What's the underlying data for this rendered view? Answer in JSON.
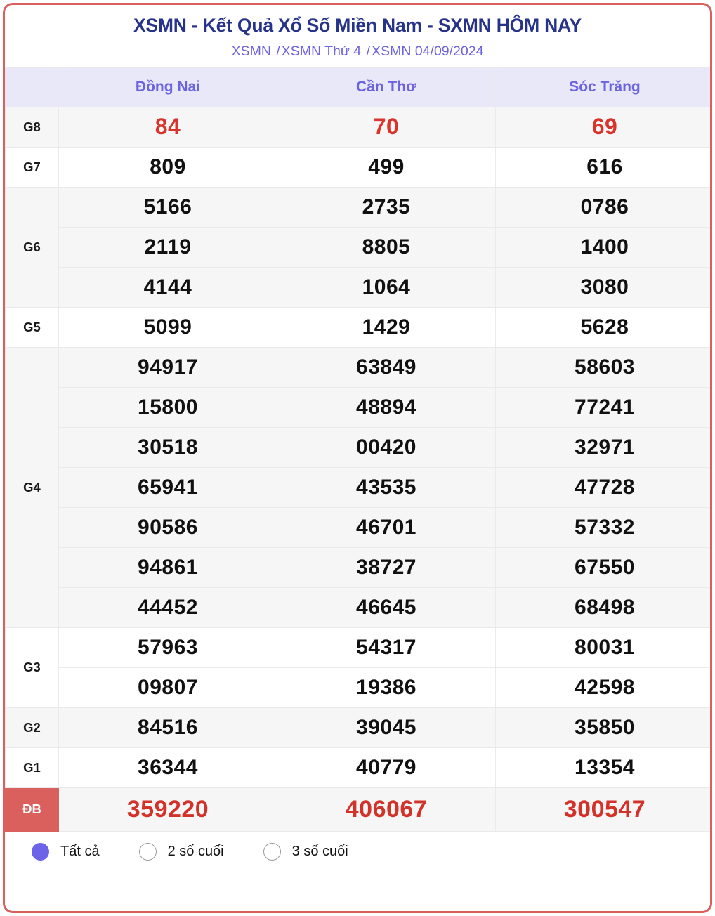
{
  "header": {
    "title": "XSMN - Kết Quả Xổ Số Miền Nam - SXMN HÔM NAY",
    "breadcrumb": {
      "items": [
        "XSMN ",
        "XSMN Thứ 4 ",
        "XSMN 04/09/2024"
      ],
      "separator": "/"
    }
  },
  "table": {
    "corner_label": "",
    "provinces": [
      "Đồng Nai",
      "Cần Thơ",
      "Sóc Trăng"
    ],
    "prizes": [
      {
        "label": "G8",
        "style": "red",
        "band": "grey",
        "rows": [
          [
            "84",
            "70",
            "69"
          ]
        ]
      },
      {
        "label": "G7",
        "style": "normal",
        "band": "white",
        "rows": [
          [
            "809",
            "499",
            "616"
          ]
        ]
      },
      {
        "label": "G6",
        "style": "normal",
        "band": "grey",
        "rows": [
          [
            "5166",
            "2735",
            "0786"
          ],
          [
            "2119",
            "8805",
            "1400"
          ],
          [
            "4144",
            "1064",
            "3080"
          ]
        ]
      },
      {
        "label": "G5",
        "style": "normal",
        "band": "white",
        "rows": [
          [
            "5099",
            "1429",
            "5628"
          ]
        ]
      },
      {
        "label": "G4",
        "style": "normal",
        "band": "grey",
        "rows": [
          [
            "94917",
            "63849",
            "58603"
          ],
          [
            "15800",
            "48894",
            "77241"
          ],
          [
            "30518",
            "00420",
            "32971"
          ],
          [
            "65941",
            "43535",
            "47728"
          ],
          [
            "90586",
            "46701",
            "57332"
          ],
          [
            "94861",
            "38727",
            "67550"
          ],
          [
            "44452",
            "46645",
            "68498"
          ]
        ]
      },
      {
        "label": "G3",
        "style": "normal",
        "band": "white",
        "rows": [
          [
            "57963",
            "54317",
            "80031"
          ],
          [
            "09807",
            "19386",
            "42598"
          ]
        ]
      },
      {
        "label": "G2",
        "style": "normal",
        "band": "grey",
        "rows": [
          [
            "84516",
            "39045",
            "35850"
          ]
        ]
      },
      {
        "label": "G1",
        "style": "normal",
        "band": "white",
        "rows": [
          [
            "36344",
            "40779",
            "13354"
          ]
        ]
      },
      {
        "label": "ĐB",
        "style": "db",
        "band": "grey",
        "rows": [
          [
            "359220",
            "406067",
            "300547"
          ]
        ]
      }
    ]
  },
  "filters": {
    "options": [
      {
        "label": "Tất cả",
        "selected": true
      },
      {
        "label": "2 số cuối",
        "selected": false
      },
      {
        "label": "3 số cuối",
        "selected": false
      }
    ]
  },
  "colors": {
    "frame_border": "#d9605c",
    "title": "#27338a",
    "link": "#6c63e0",
    "header_bg": "#e9e8f9",
    "highlight_red": "#d9342b",
    "db_bg": "#d9605c",
    "radio_on": "#6c63e8",
    "band_grey": "#f6f6f6"
  }
}
